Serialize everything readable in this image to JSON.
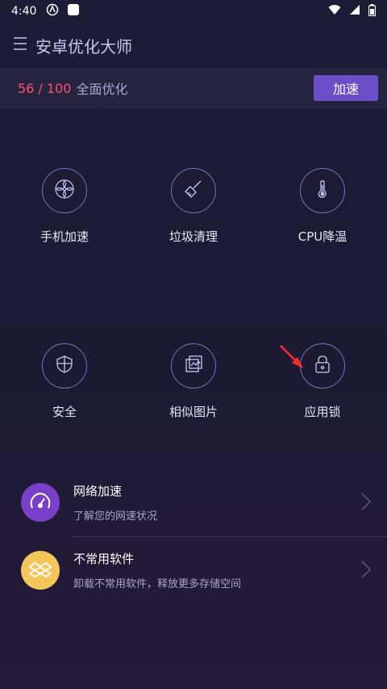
{
  "status_bar": {
    "time": "4:40"
  },
  "header": {
    "title": "安卓优化大师"
  },
  "score": {
    "value": "56 / 100",
    "label": "全面优化",
    "button": "加速"
  },
  "tools": [
    {
      "label": "手机加速",
      "icon": "fan-icon"
    },
    {
      "label": "垃圾清理",
      "icon": "broom-icon"
    },
    {
      "label": "CPU降温",
      "icon": "thermometer-icon"
    },
    {
      "label": "安全",
      "icon": "shield-icon"
    },
    {
      "label": "相似图片",
      "icon": "image-icon"
    },
    {
      "label": "应用锁",
      "icon": "lock-icon"
    }
  ],
  "list": [
    {
      "title": "网络加速",
      "subtitle": "了解您的网速状况",
      "icon": "speedometer-icon",
      "color": "#7a3fc9"
    },
    {
      "title": "不常用软件",
      "subtitle": "卸载不常用软件，释放更多存储空间",
      "icon": "box-icon",
      "color": "#f4c65a"
    }
  ],
  "colors": {
    "accent": "#6a4fc9",
    "score": "#ff4f6b"
  }
}
